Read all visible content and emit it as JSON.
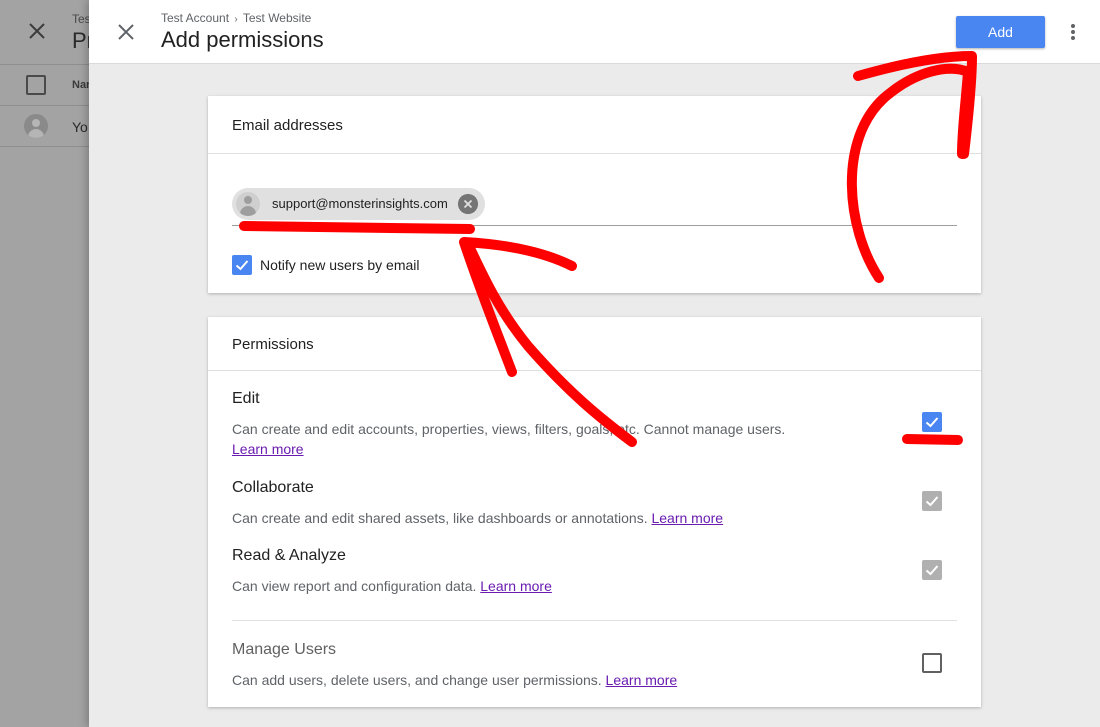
{
  "background_page": {
    "breadcrumb_fragment": "Tes",
    "title_fragment": "Pr",
    "column_header_fragment": "Nar",
    "row_text_fragment": "Yo"
  },
  "header": {
    "breadcrumb_account": "Test Account",
    "breadcrumb_separator": "›",
    "breadcrumb_property": "Test Website",
    "title": "Add permissions",
    "add_label": "Add"
  },
  "email_section": {
    "heading": "Email addresses",
    "chip_email": "support@monsterinsights.com",
    "notify_label": "Notify new users by email",
    "notify_checked": true
  },
  "permissions_section": {
    "heading": "Permissions",
    "items": [
      {
        "title": "Edit",
        "description": "Can create and edit accounts, properties, views, filters, goals, etc. Cannot manage users.",
        "link": "Learn more",
        "state": "checked"
      },
      {
        "title": "Collaborate",
        "description": "Can create and edit shared assets, like dashboards or annotations.",
        "link": "Learn more",
        "state": "checked-disabled"
      },
      {
        "title": "Read & Analyze",
        "description": "Can view report and configuration data.",
        "link": "Learn more",
        "state": "checked-disabled"
      },
      {
        "title": "Manage Users",
        "description": "Can add users, delete users, and change user permissions.",
        "link": "Learn more",
        "state": "unchecked"
      }
    ]
  },
  "colors": {
    "accent_blue": "#4a86f2",
    "annotation_red": "#ff0000",
    "link_purple": "#6a1bb0"
  }
}
